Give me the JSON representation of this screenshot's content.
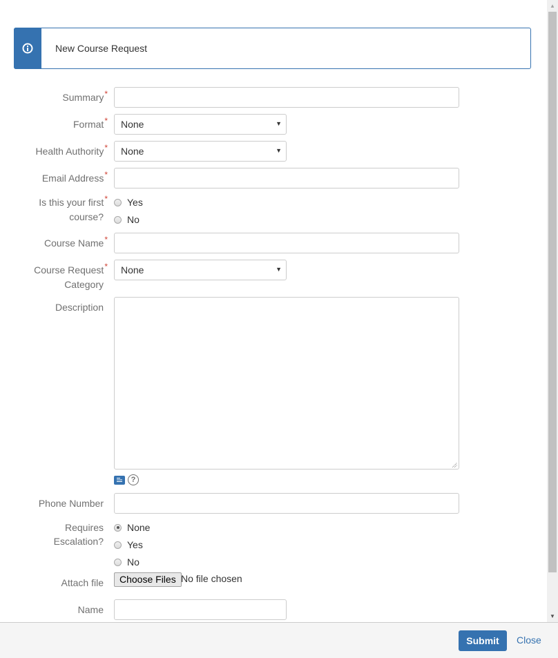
{
  "banner": {
    "icon": "info-icon",
    "title": "New Course Request"
  },
  "form": {
    "summary": {
      "label": "Summary",
      "required": "*",
      "value": ""
    },
    "format": {
      "label": "Format",
      "required": "*",
      "selected": "None"
    },
    "health_authority": {
      "label": "Health Authority",
      "required": "*",
      "selected": "None"
    },
    "email": {
      "label": "Email Address",
      "required": "*",
      "value": ""
    },
    "first_course": {
      "label_line1": "Is this your first",
      "label_line2": "course?",
      "required": "*",
      "options": [
        "Yes",
        "No"
      ],
      "selected": null
    },
    "course_name": {
      "label": "Course Name",
      "required": "*",
      "value": ""
    },
    "course_request_category": {
      "label_line1": "Course Request",
      "label_line2": "Category",
      "required": "*",
      "selected": "None"
    },
    "description": {
      "label": "Description",
      "value": "",
      "toolbar_icons": [
        "document-icon",
        "help-icon"
      ],
      "help_glyph": "?"
    },
    "phone": {
      "label": "Phone Number",
      "value": ""
    },
    "requires_escalation": {
      "label_line1": "Requires",
      "label_line2": "Escalation?",
      "options": [
        "None",
        "Yes",
        "No"
      ],
      "selected": "None"
    },
    "attach_file": {
      "label": "Attach file",
      "button_label": "Choose Files",
      "status": "No file chosen"
    },
    "name": {
      "label": "Name",
      "value": ""
    }
  },
  "footer": {
    "submit_label": "Submit",
    "close_label": "Close"
  },
  "colors": {
    "accent": "#3572b0",
    "required": "#d04437",
    "label": "#707070"
  }
}
